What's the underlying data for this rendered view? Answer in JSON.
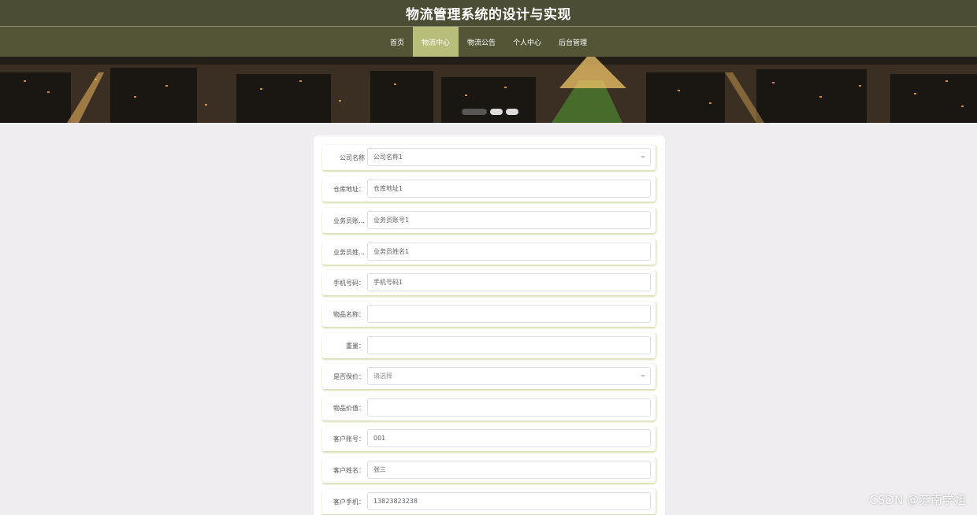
{
  "header": {
    "title": "物流管理系统的设计与实现"
  },
  "nav": {
    "items": [
      {
        "label": "首页",
        "active": false
      },
      {
        "label": "物流中心",
        "active": true
      },
      {
        "label": "物流公告",
        "active": false
      },
      {
        "label": "个人中心",
        "active": false
      },
      {
        "label": "后台管理",
        "active": false
      }
    ]
  },
  "form": {
    "fields": [
      {
        "label": "公司名称",
        "value": "公司名称1",
        "type": "select"
      },
      {
        "label": "仓库地址：",
        "value": "仓库地址1",
        "type": "input"
      },
      {
        "label": "业务员账…",
        "value": "业务员账号1",
        "type": "input"
      },
      {
        "label": "业务员姓…",
        "value": "业务员姓名1",
        "type": "input"
      },
      {
        "label": "手机号码：",
        "value": "手机号码1",
        "type": "input"
      },
      {
        "label": "物品名称：",
        "value": "",
        "type": "input"
      },
      {
        "label": "重量：",
        "value": "",
        "type": "input"
      },
      {
        "label": "是否保价：",
        "value": "",
        "placeholder": "请选择",
        "type": "select"
      },
      {
        "label": "物品价值：",
        "value": "",
        "type": "input"
      },
      {
        "label": "客户账号：",
        "value": "001",
        "type": "input"
      },
      {
        "label": "客户姓名：",
        "value": "张三",
        "type": "input"
      },
      {
        "label": "客户手机：",
        "value": "13823823238",
        "type": "input"
      }
    ]
  },
  "watermark": "CSDN @苏南学姐",
  "colors": {
    "title_bg": "#4b4d35",
    "nav_bg": "#545536",
    "nav_active": "#b9bd7a",
    "page_bg": "#efedef"
  }
}
